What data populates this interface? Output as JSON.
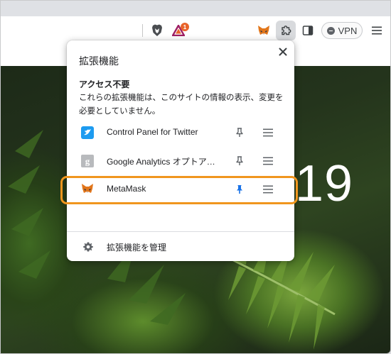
{
  "toolbar": {
    "vpn_label": "VPN",
    "notification_count": "1"
  },
  "page": {
    "clock_fragment": "19"
  },
  "popup": {
    "title": "拡張機能",
    "section_title": "アクセス不要",
    "section_description": "これらの拡張機能は、このサイトの情報の表示、変更を必要としていません。",
    "extensions": [
      {
        "name": "Control Panel for Twitter",
        "icon": "twitter-bird-icon",
        "pinned": false
      },
      {
        "name": "Google Analytics オプトアウト アドオン",
        "icon": "google-analytics-icon",
        "pinned": false
      },
      {
        "name": "MetaMask",
        "icon": "metamask-fox-icon",
        "pinned": true,
        "highlighted": true
      }
    ],
    "manage_label": "拡張機能を管理"
  },
  "colors": {
    "pin_active": "#1a73e8",
    "pin_inactive": "#5f6368",
    "highlight": "#f0961e",
    "badge": "#e8632a"
  }
}
